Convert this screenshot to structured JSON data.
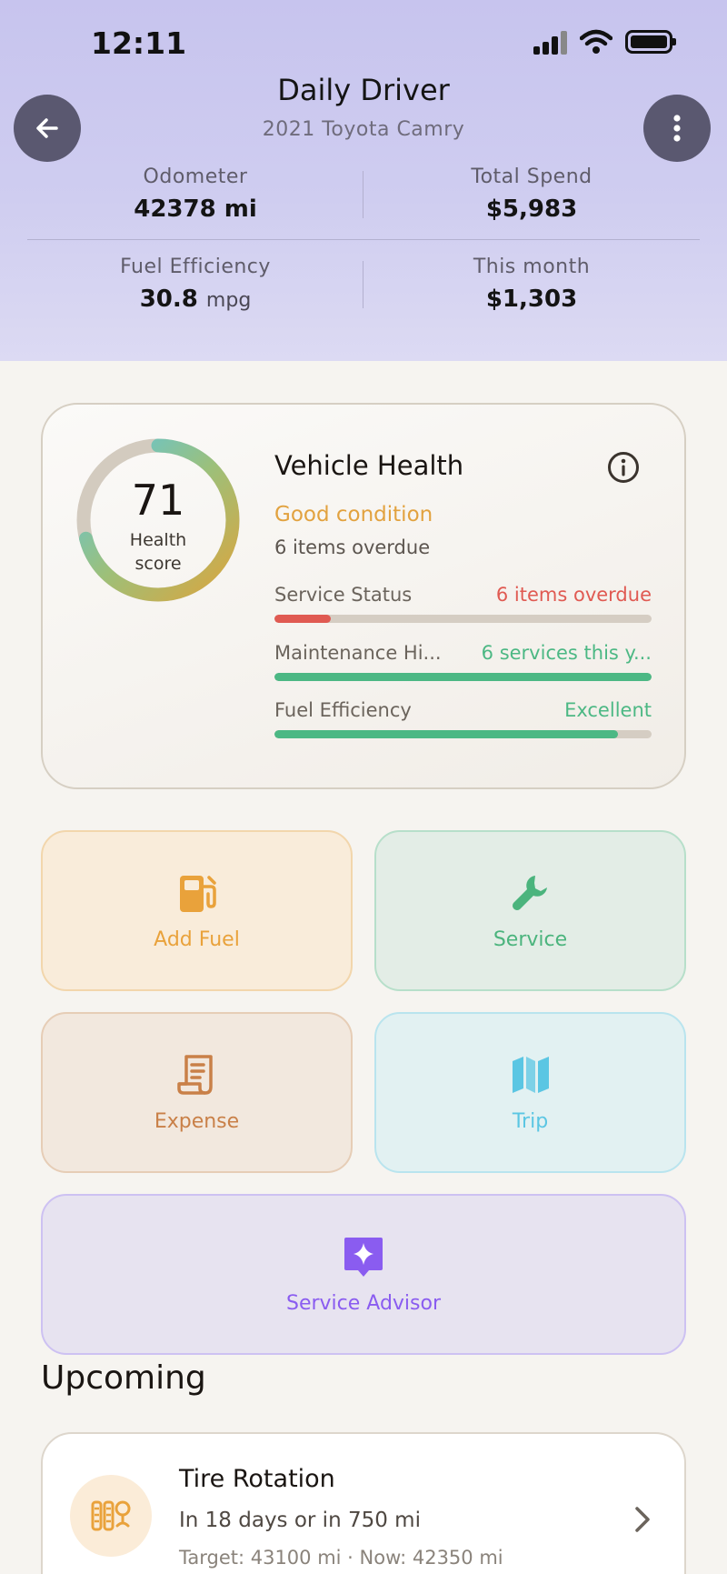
{
  "status_bar": {
    "time": "12:11"
  },
  "header": {
    "title": "Daily Driver",
    "subtitle": "2021 Toyota Camry",
    "stats": {
      "odometer": {
        "label": "Odometer",
        "value": "42378 mi"
      },
      "total_spend": {
        "label": "Total Spend",
        "value": "$5,983"
      },
      "fuel_efficiency": {
        "label": "Fuel Efficiency",
        "value": "30.8",
        "unit": "mpg"
      },
      "this_month": {
        "label": "This month",
        "value": "$1,303"
      }
    }
  },
  "health": {
    "score": "71",
    "score_label_line1": "Health",
    "score_label_line2": "score",
    "score_fraction": 0.71,
    "title": "Vehicle Health",
    "condition": "Good condition",
    "overdue_summary": "6 items overdue",
    "metrics": [
      {
        "name": "Service Status",
        "status": "6 items overdue",
        "level": 0.15,
        "color": "#e05a52"
      },
      {
        "name": "Maintenance Hi...",
        "status": "6 services this y...",
        "level": 1.0,
        "color": "#4cb884"
      },
      {
        "name": "Fuel Efficiency",
        "status": "Excellent",
        "level": 0.91,
        "color": "#4cb884"
      }
    ],
    "colors": {
      "good": "#e2a23f",
      "ring_start": "#dba53e",
      "ring_end": "#5bc6e3"
    }
  },
  "actions": {
    "add_fuel": {
      "label": "Add Fuel",
      "icon": "fuel-pump-icon",
      "color": "#e9a23b"
    },
    "service": {
      "label": "Service",
      "icon": "wrench-icon",
      "color": "#4bb47d"
    },
    "expense": {
      "label": "Expense",
      "icon": "receipt-icon",
      "color": "#c98048"
    },
    "trip": {
      "label": "Trip",
      "icon": "map-icon",
      "color": "#5bc6e3"
    },
    "advisor": {
      "label": "Service Advisor",
      "icon": "sparkle-chat-icon",
      "color": "#8a5cf0"
    }
  },
  "upcoming": {
    "title": "Upcoming",
    "items": [
      {
        "name": "Tire Rotation",
        "when": "In 18 days or in 750 mi",
        "target": "Target: 43100 mi · Now: 42350 mi",
        "icon": "tire-rotation-icon"
      }
    ]
  }
}
